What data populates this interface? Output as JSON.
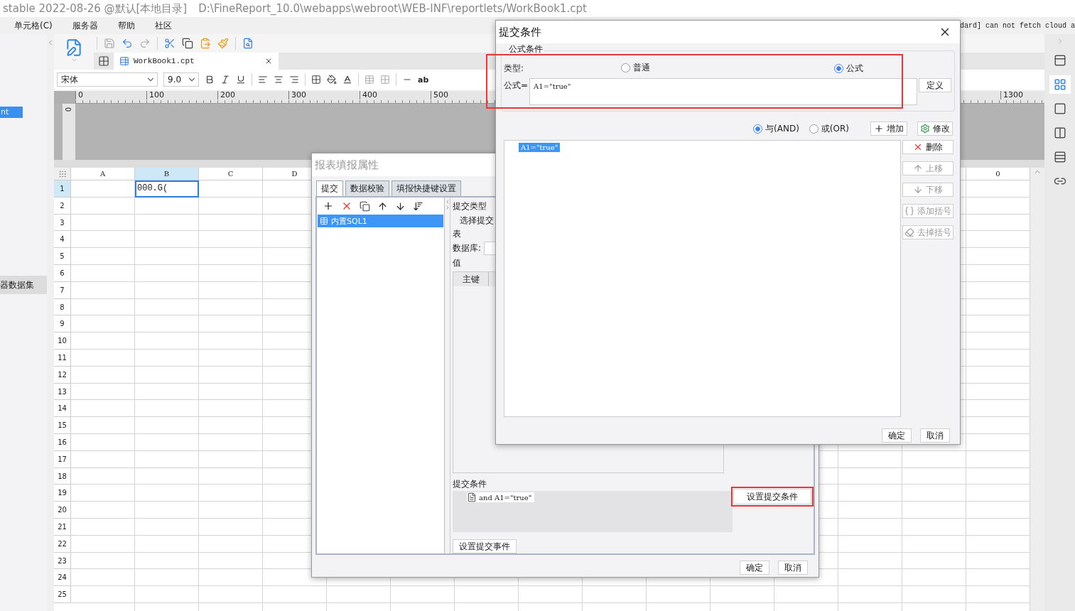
{
  "window": {
    "title": "stable 2022-08-26 @默认[本地目录]",
    "path": "D:\\FineReport_10.0\\webapps\\webroot\\WEB-INF\\reportlets/WorkBook1.cpt"
  },
  "menu": [
    "单元格(C)",
    "服务器",
    "帮助",
    "社区"
  ],
  "console_text": "dard] can not fetch cloud a",
  "left_panel": {
    "selected_item": "nt",
    "section_title": "器数据集"
  },
  "file_tabs": [
    {
      "label": "WorkBook1.cpt",
      "selected": true
    }
  ],
  "format_bar": {
    "font": "宋体",
    "size": "9.0",
    "text_button": "ab"
  },
  "ruler": {
    "labels": [
      "0",
      "100",
      "200",
      "300",
      "400",
      "500"
    ],
    "far_label": "1300",
    "vertical_label": "0"
  },
  "sheet": {
    "columns": [
      {
        "label": "A",
        "selected": false
      },
      {
        "label": "B",
        "selected": true
      },
      {
        "label": "C",
        "selected": false
      },
      {
        "label": "D",
        "selected": false
      }
    ],
    "far_column": "0",
    "rows": [
      {
        "label": "1",
        "selected": true
      },
      {
        "label": "2",
        "selected": false
      },
      {
        "label": "3",
        "selected": false
      },
      {
        "label": "4",
        "selected": false
      },
      {
        "label": "5",
        "selected": false
      },
      {
        "label": "6",
        "selected": false
      },
      {
        "label": "7",
        "selected": false
      },
      {
        "label": "8",
        "selected": false
      },
      {
        "label": "9",
        "selected": false
      },
      {
        "label": "10",
        "selected": false
      },
      {
        "label": "11",
        "selected": false
      },
      {
        "label": "12",
        "selected": false
      },
      {
        "label": "13",
        "selected": false
      },
      {
        "label": "14",
        "selected": false
      },
      {
        "label": "15",
        "selected": false
      },
      {
        "label": "16",
        "selected": false
      },
      {
        "label": "17",
        "selected": false
      },
      {
        "label": "18",
        "selected": false
      },
      {
        "label": "19",
        "selected": false
      },
      {
        "label": "20",
        "selected": false
      },
      {
        "label": "21",
        "selected": false
      },
      {
        "label": "22",
        "selected": false
      },
      {
        "label": "23",
        "selected": false
      },
      {
        "label": "24",
        "selected": false
      },
      {
        "label": "25",
        "selected": false
      }
    ],
    "active_cell": "000.G("
  },
  "right_sidebar": [
    {
      "selected": false
    },
    {
      "selected": true
    },
    {
      "selected": false
    },
    {
      "selected": false
    },
    {
      "selected": false
    },
    {
      "selected": false
    }
  ],
  "fill_dialog": {
    "title": "报表填报属性",
    "tabs": [
      {
        "label": "提交",
        "selected": true
      },
      {
        "label": "数据校验",
        "selected": false
      },
      {
        "label": "填报快捷键设置",
        "selected": false
      }
    ],
    "list_items": [
      {
        "label": "内置SQL1",
        "selected": true
      }
    ],
    "submit_type_label": "提交类型",
    "submit_type_text": "选择提交",
    "table_label": "表",
    "database_label": "数据库:",
    "values_label": "值",
    "key_column": "主键",
    "condition_label": "提交条件",
    "condition_item": "and A1=\"true\"",
    "condition_button": {
      "label": "设置提交条件",
      "highlighted": true
    },
    "event_button": "设置提交事件",
    "buttons": [
      "确定",
      "取消"
    ]
  },
  "condition_dialog": {
    "title": "提交条件",
    "group_title": "公式条件",
    "highlighted": true,
    "type_label": "类型:",
    "types": [
      {
        "label": "普通",
        "selected": false
      },
      {
        "label": "公式",
        "selected": true
      }
    ],
    "formula_label": "公式=",
    "formula": "A1=\"true\"",
    "define_button": "定义",
    "logic": [
      {
        "label": "与(AND)",
        "selected": true
      },
      {
        "label": "或(OR)",
        "selected": false
      }
    ],
    "add_button": "增加",
    "edit_button": "修改",
    "conditions": [
      {
        "label": "A1=\"true\"",
        "selected": true
      }
    ],
    "side_buttons": [
      {
        "label": "删除",
        "kind": "delete",
        "disabled": false
      },
      {
        "label": "上移",
        "kind": "up",
        "disabled": true
      },
      {
        "label": "下移",
        "kind": "down",
        "disabled": true
      },
      {
        "label": "添加括号",
        "kind": "add_paren",
        "disabled": true
      },
      {
        "label": "去掉括号",
        "kind": "remove_paren",
        "disabled": true
      }
    ],
    "buttons": [
      "确定",
      "取消"
    ]
  }
}
